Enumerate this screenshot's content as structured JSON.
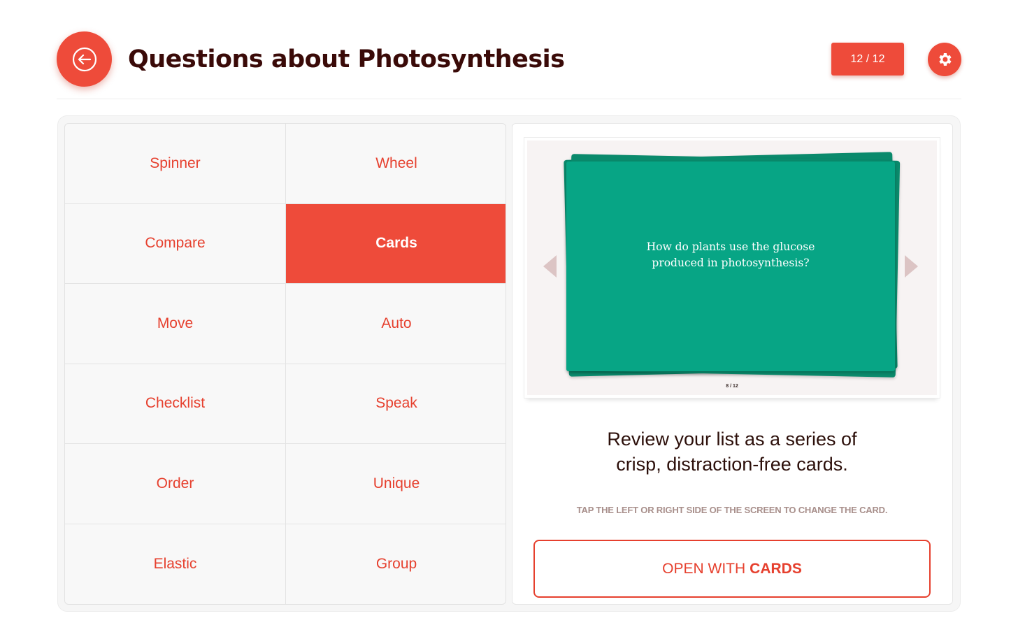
{
  "header": {
    "title": "Questions about Photosynthesis",
    "counter": "12 / 12"
  },
  "modes": [
    {
      "label": "Spinner",
      "active": false
    },
    {
      "label": "Wheel",
      "active": false
    },
    {
      "label": "Compare",
      "active": false
    },
    {
      "label": "Cards",
      "active": true
    },
    {
      "label": "Move",
      "active": false
    },
    {
      "label": "Auto",
      "active": false
    },
    {
      "label": "Checklist",
      "active": false
    },
    {
      "label": "Speak",
      "active": false
    },
    {
      "label": "Order",
      "active": false
    },
    {
      "label": "Unique",
      "active": false
    },
    {
      "label": "Elastic",
      "active": false
    },
    {
      "label": "Group",
      "active": false
    }
  ],
  "preview": {
    "question": "How do plants use the glucose produced in photosynthesis?",
    "card_index": "8 / 12"
  },
  "detail": {
    "description_line1": "Review your list as a series of",
    "description_line2": "crisp, distraction-free cards.",
    "hint": "TAP THE LEFT OR RIGHT SIDE OF THE SCREEN TO CHANGE THE CARD.",
    "open_prefix": "OPEN WITH",
    "open_mode": "CARDS"
  },
  "colors": {
    "accent": "#ee4b3a",
    "card": "#07a585",
    "title": "#3a0a08"
  },
  "icons": {
    "back": "arrow-left-circle-icon",
    "settings": "gear-icon",
    "prev": "triangle-left-icon",
    "next": "triangle-right-icon"
  }
}
